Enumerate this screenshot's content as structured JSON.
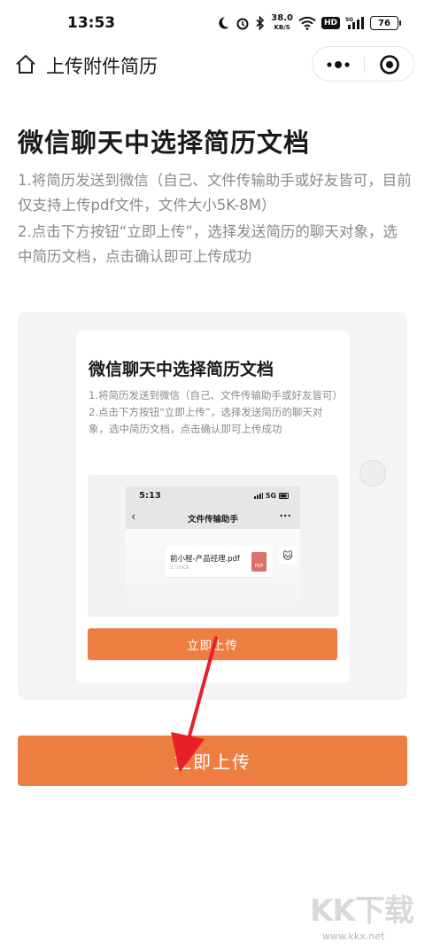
{
  "status_bar": {
    "time": "13:53",
    "speed_value": "38.0",
    "speed_unit": "KB/S",
    "hd_label": "HD",
    "battery": "76"
  },
  "nav": {
    "title": "上传附件简历"
  },
  "main": {
    "title": "微信聊天中选择简历文档",
    "steps": [
      "1.将简历发送到微信（自己、文件传输助手或好友皆可，目前仅支持上传pdf文件，文件大小5K-8M）",
      "2.点击下方按钮“立即上传”，选择发送简历的聊天对象，选中简历文档，点击确认即可上传成功"
    ],
    "upload_button": "立即上传"
  },
  "preview": {
    "title": "微信聊天中选择简历文档",
    "steps": [
      "1.将简历发送到微信（自己、文件传输助手或好友皆可）",
      "2.点击下方按钮“立即上传”，选择发送简历的聊天对象，选中简历文档，点击确认即可上传成功"
    ],
    "phone": {
      "time": "5:13",
      "network": "5G",
      "chat_title": "文件传输助手",
      "file_name": "前小程-产品经理.pdf",
      "file_size": "2.56KB",
      "pdf_label": "PDF"
    },
    "button": "立即上传"
  },
  "watermark": {
    "logo": "KK下载",
    "url": "www.kkx.net"
  },
  "colors": {
    "accent": "#ee7d42",
    "arrow": "#e8202a"
  }
}
